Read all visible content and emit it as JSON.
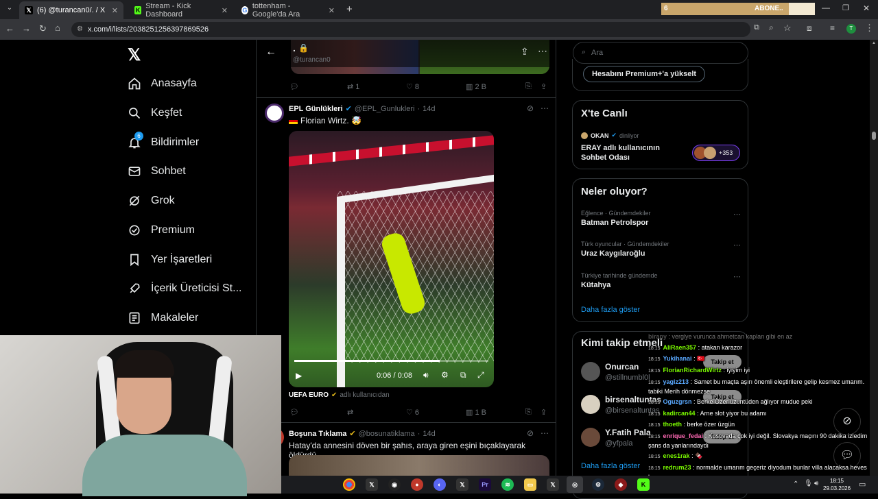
{
  "browser": {
    "tabs": [
      {
        "title": "(6) @turancan0/. / X",
        "active": true
      },
      {
        "title": "Stream - Kick Dashboard",
        "active": false
      },
      {
        "title": "tottenham - Google'da Ara",
        "active": false
      }
    ],
    "new_tab": "+",
    "url": "x.com/i/lists/2038251256397869526",
    "overlay_left": "6",
    "overlay_right": "ABONE.."
  },
  "nav": {
    "items": [
      {
        "label": "Anasayfa",
        "icon": "home-icon"
      },
      {
        "label": "Keşfet",
        "icon": "search-icon"
      },
      {
        "label": "Bildirimler",
        "icon": "bell-icon",
        "badge": "6"
      },
      {
        "label": "Sohbet",
        "icon": "mail-icon"
      },
      {
        "label": "Grok",
        "icon": "grok-icon"
      },
      {
        "label": "Premium",
        "icon": "verified-icon"
      },
      {
        "label": "Yer İşaretleri",
        "icon": "bookmark-icon"
      },
      {
        "label": "İçerik Üreticisi St...",
        "icon": "rocket-icon"
      },
      {
        "label": "Makaleler",
        "icon": "article-icon"
      }
    ]
  },
  "header": {
    "title": ".",
    "handle": "@turancan0"
  },
  "post0": {
    "reply": "",
    "retweet": "1",
    "like": "8",
    "views": "2 B"
  },
  "post1": {
    "name": "EPL Günlükleri",
    "handle": "@EPL_Gunlukleri",
    "time": "14d",
    "text": "Florian Wirtz. 🤯",
    "video_time": "0:06 / 0:08",
    "source_name": "UEFA EURO",
    "source_suffix": "adlı kullanıcıdan",
    "reply": "",
    "retweet": "",
    "like": "6",
    "views": "1 B"
  },
  "post2": {
    "name": "Boşuna Tıklama",
    "handle": "@bosunatiklama",
    "time": "14d",
    "text": "Hatay'da annesini döven bir şahıs, araya giren eşini bıçaklayarak öldürdü."
  },
  "right": {
    "search_placeholder": "Ara",
    "premium_btn": "Hesabını Premium+'a yükselt",
    "live_title": "X'te Canlı",
    "live_host": "OKAN",
    "live_status": "dinliyor",
    "live_room": "ERAY adlı kullanıcının Sohbet Odası",
    "live_count": "+353",
    "trends_title": "Neler oluyor?",
    "trends": [
      {
        "meta": "Eğlence · Gündemdekiler",
        "name": "Batman Petrolspor"
      },
      {
        "meta": "Türk oyuncular · Gündemdekiler",
        "name": "Uraz Kaygılaroğlu"
      },
      {
        "meta": "Türkiye tarihinde gündemde",
        "name": "Kütahya"
      }
    ],
    "show_more": "Daha fazla göster",
    "follow_title": "Kimi takip etmeli",
    "follow": [
      {
        "name": "Onurcan",
        "handle": "@stillnumbl0l"
      },
      {
        "name": "birsenaltuntas",
        "handle": "@birsenaltuntas"
      },
      {
        "name": "Y.Fatih Pala",
        "handle": "@yfpala"
      }
    ],
    "follow_btn": "Takip et",
    "show_more2": "Daha fazla göster"
  },
  "chat": [
    {
      "time": "",
      "user": "birapy",
      "msg": "verglye vurunca ahmetcan kaplan gibi en az",
      "color": "#aaaaaa"
    },
    {
      "time": "18:15",
      "user": "AliRaen357",
      "msg": "atakan karazor",
      "color": "#7CFC00"
    },
    {
      "time": "18:15",
      "user": "Yukihanai",
      "msg": "🇹🇷",
      "color": "#5aa9ff"
    },
    {
      "time": "18:15",
      "user": "FlorianRichardWirtz",
      "msg": "iyiyim iyi",
      "color": "#7CFC00"
    },
    {
      "time": "18:15",
      "user": "yagiz213",
      "msg": "Samet bu maçta aşırı önemli eleştirilere gelip kesmez umarım. tabiki Merih dönmezse",
      "color": "#5aa9ff"
    },
    {
      "time": "18:15",
      "user": "Oguzgrsn",
      "msg": "Berke Özer uzuntüden ağlıyor mudue peki",
      "color": "#5aa9ff"
    },
    {
      "time": "18:15",
      "user": "kadircan44",
      "msg": "Arne slot yiyor bu adamı",
      "color": "#7CFC00"
    },
    {
      "time": "18:15",
      "user": "thoeth",
      "msg": "berke özer üzgün",
      "color": "#7CFC00"
    },
    {
      "time": "18:15",
      "user": "enrique_fedai",
      "msg": "Kosovada çok iyi değil. Slovakya maçını 90 dakika izledim şans da yanlarındaydı",
      "color": "#ff69b4"
    },
    {
      "time": "18:15",
      "user": "enes1rak",
      "msg": "🍫",
      "color": "#7CFC00"
    },
    {
      "time": "18:15",
      "user": "redrum23",
      "msg": "normalde umarım geçeriz diyodum bunlar villa alacaksa heves kaçar",
      "color": "#7CFC00"
    }
  ],
  "taskbar": {
    "time": "18:15",
    "date": "29.03.2026"
  },
  "colors": {
    "x_bg": "#000000",
    "accent": "#1d9bf0",
    "chat_user_green": "#7CFC00"
  }
}
